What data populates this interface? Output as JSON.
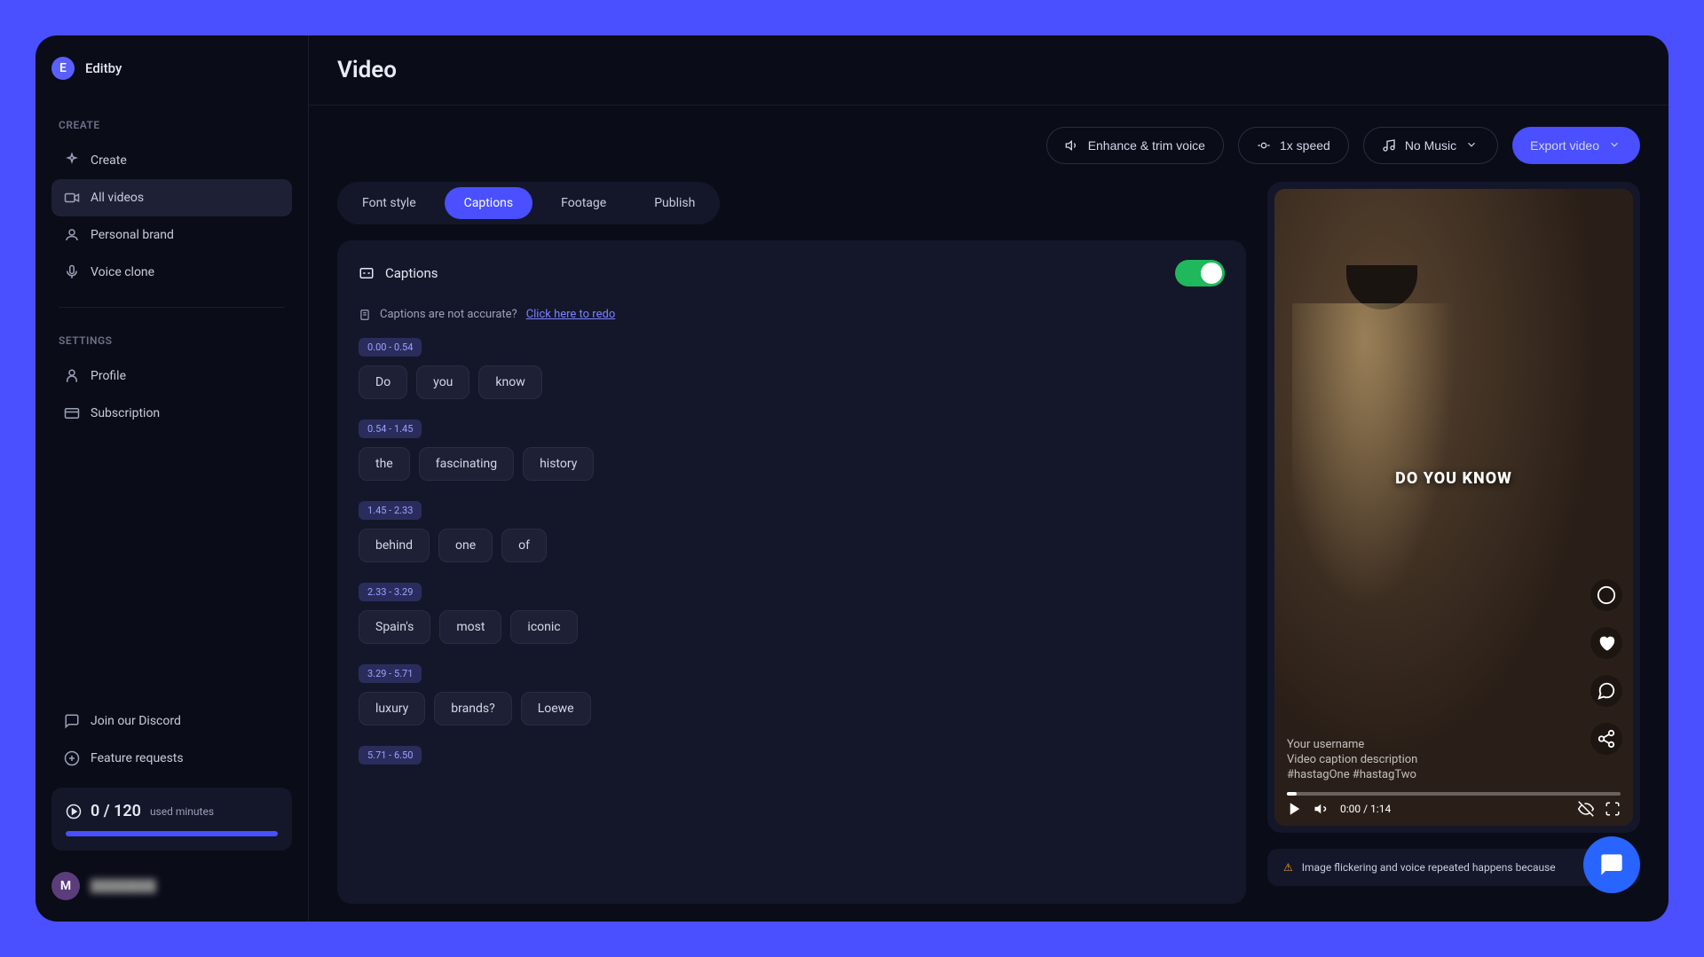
{
  "brand": {
    "initial": "E",
    "name": "Editby"
  },
  "sidebar": {
    "create_label": "CREATE",
    "settings_label": "SETTINGS",
    "items_create": [
      {
        "icon": "sparkle",
        "label": "Create"
      },
      {
        "icon": "video",
        "label": "All videos",
        "active": true
      },
      {
        "icon": "person",
        "label": "Personal brand"
      },
      {
        "icon": "microphone",
        "label": "Voice clone"
      }
    ],
    "items_settings": [
      {
        "icon": "user",
        "label": "Profile"
      },
      {
        "icon": "card",
        "label": "Subscription"
      }
    ],
    "footer_links": [
      {
        "icon": "chat",
        "label": "Join our Discord"
      },
      {
        "icon": "plus",
        "label": "Feature requests"
      }
    ],
    "usage": {
      "value": "0 / 120",
      "suffix": "used minutes"
    },
    "avatar_initial": "M"
  },
  "header": {
    "title": "Video"
  },
  "toolbar": {
    "enhance": "Enhance & trim voice",
    "speed": "1x speed",
    "music": "No Music",
    "export": "Export video"
  },
  "tabs": [
    {
      "label": "Font style"
    },
    {
      "label": "Captions",
      "active": true
    },
    {
      "label": "Footage"
    },
    {
      "label": "Publish"
    }
  ],
  "captions_panel": {
    "title": "Captions",
    "hint_text": "Captions are not accurate?",
    "hint_link": "Click here to redo",
    "groups": [
      {
        "time": "0.00 - 0.54",
        "words": [
          "Do",
          "you",
          "know"
        ]
      },
      {
        "time": "0.54 - 1.45",
        "words": [
          "the",
          "fascinating",
          "history"
        ]
      },
      {
        "time": "1.45 - 2.33",
        "words": [
          "behind",
          "one",
          "of"
        ]
      },
      {
        "time": "2.33 - 3.29",
        "words": [
          "Spain's",
          "most",
          "iconic"
        ]
      },
      {
        "time": "3.29 - 5.71",
        "words": [
          "luxury",
          "brands?",
          "Loewe"
        ]
      },
      {
        "time": "5.71 - 6.50",
        "words": []
      }
    ]
  },
  "preview": {
    "caption_text": "DO YOU KNOW",
    "username": "Your username",
    "description": "Video caption description",
    "hashtags": "#hastagOne #hastagTwo",
    "time": "0:00 / 1:14"
  },
  "warning": "Image flickering and voice repeated happens because"
}
